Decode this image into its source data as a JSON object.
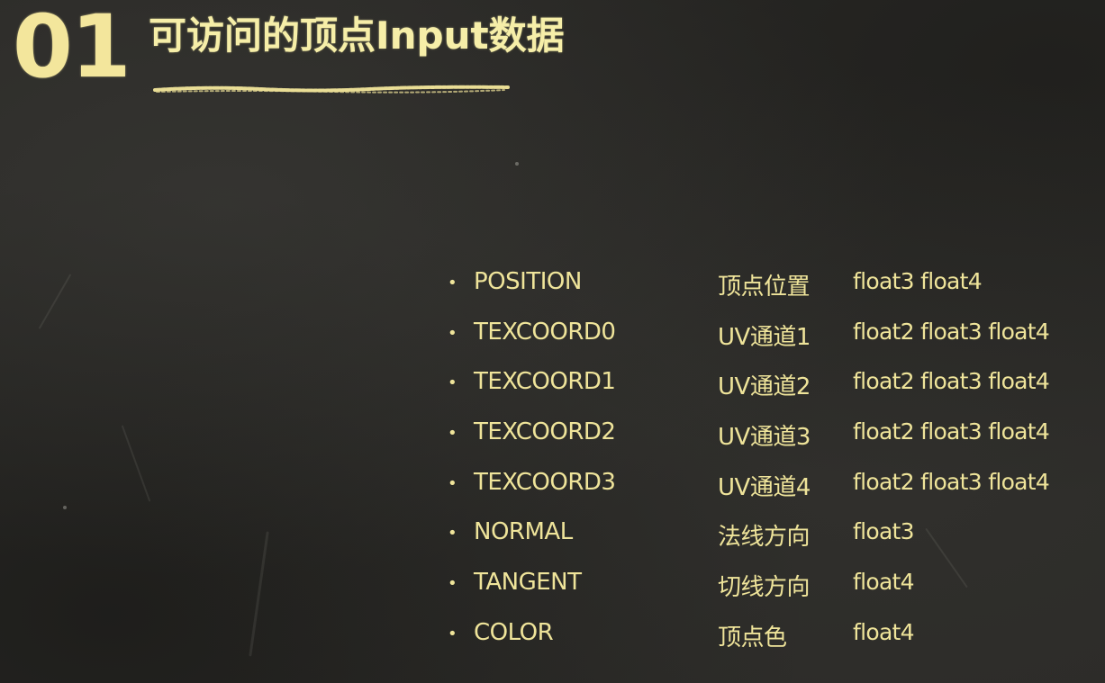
{
  "slide": {
    "number": "01",
    "title": "可访问的顶点Input数据"
  },
  "attributes": [
    {
      "semantic": "POSITION",
      "description": "顶点位置",
      "types": "float3 float4"
    },
    {
      "semantic": "TEXCOORD0",
      "description": "UV通道1",
      "types": "float2 float3 float4"
    },
    {
      "semantic": "TEXCOORD1",
      "description": "UV通道2",
      "types": "float2 float3 float4"
    },
    {
      "semantic": "TEXCOORD2",
      "description": "UV通道3",
      "types": "float2 float3 float4"
    },
    {
      "semantic": "TEXCOORD3",
      "description": "UV通道4",
      "types": "float2 float3 float4"
    },
    {
      "semantic": "NORMAL",
      "description": "法线方向",
      "types": "float3"
    },
    {
      "semantic": "TANGENT",
      "description": "切线方向",
      "types": "float4"
    },
    {
      "semantic": "COLOR",
      "description": "顶点色",
      "types": "float4"
    }
  ],
  "colors": {
    "chalk_yellow": "#efe49a",
    "board": "#2b2a27"
  }
}
